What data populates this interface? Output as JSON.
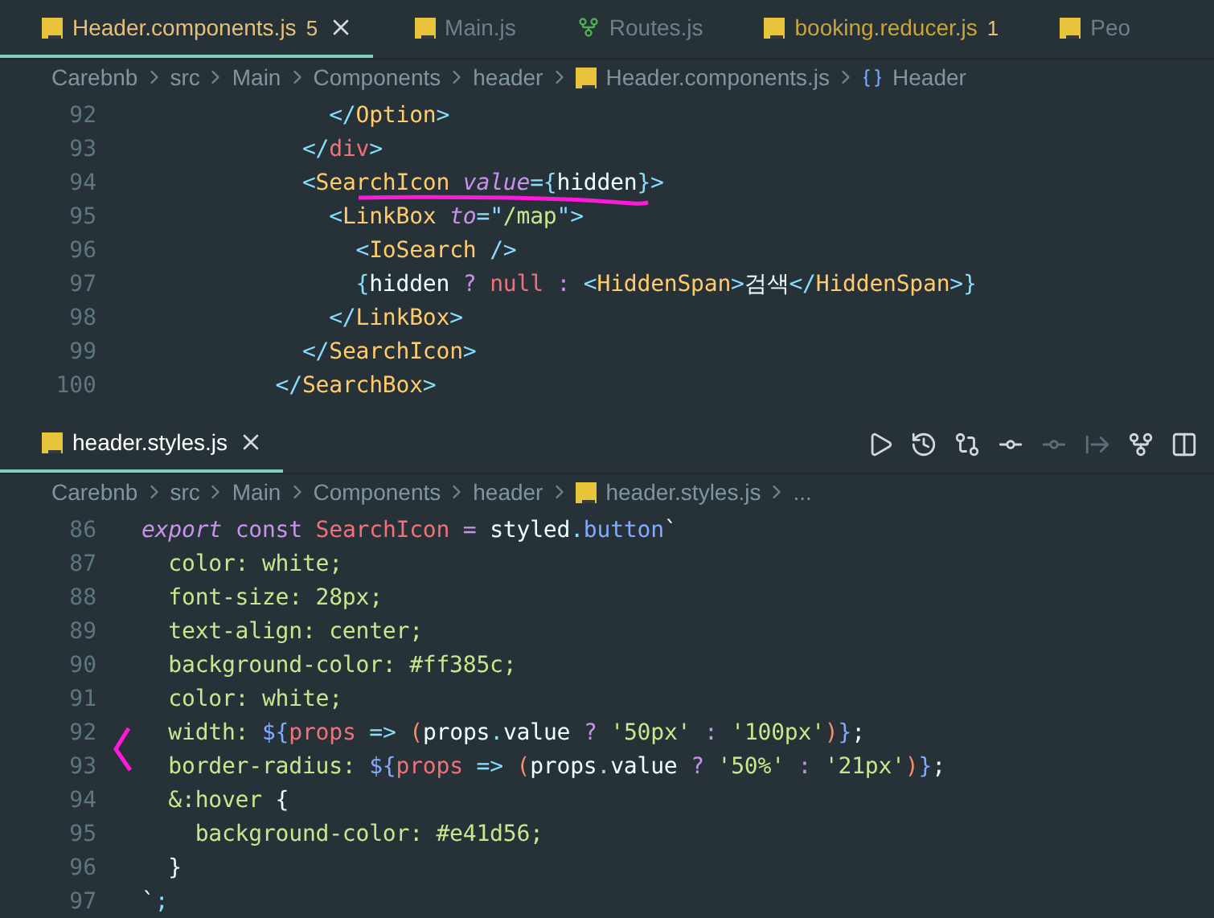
{
  "top_editor": {
    "tabs": [
      {
        "label": "Header.components.js",
        "badge": "5",
        "selected": true,
        "kind": "js",
        "warning": true
      },
      {
        "label": "Main.js",
        "selected": false,
        "kind": "js",
        "warning": false
      },
      {
        "label": "Routes.js",
        "selected": false,
        "kind": "routes",
        "warning": false
      },
      {
        "label": "booking.reducer.js",
        "badge": "1",
        "selected": false,
        "kind": "js",
        "warning": true
      },
      {
        "label": "Peo",
        "selected": false,
        "kind": "js",
        "warning": false
      }
    ],
    "breadcrumbs": [
      {
        "kind": "folder",
        "label": "Carebnb"
      },
      {
        "kind": "folder",
        "label": "src"
      },
      {
        "kind": "folder",
        "label": "Main"
      },
      {
        "kind": "folder",
        "label": "Components"
      },
      {
        "kind": "folder",
        "label": "header"
      },
      {
        "kind": "js",
        "label": "Header.components.js"
      },
      {
        "kind": "symbol",
        "label": "Header"
      }
    ],
    "lines": [
      {
        "number": "92",
        "tokens": [
          {
            "kind": "p",
            "text": "              </"
          },
          {
            "kind": "tag",
            "text": "Option"
          },
          {
            "kind": "p",
            "text": ">"
          }
        ]
      },
      {
        "number": "93",
        "tokens": [
          {
            "kind": "p",
            "text": "            </"
          },
          {
            "kind": "kw",
            "text": "div"
          },
          {
            "kind": "p",
            "text": ">"
          }
        ]
      },
      {
        "number": "94",
        "underlined": true,
        "tokens": [
          {
            "kind": "p",
            "text": "            <"
          },
          {
            "kind": "tag",
            "text": "SearchIcon "
          },
          {
            "kind": "attr",
            "text": "value"
          },
          {
            "kind": "p",
            "text": "={"
          },
          {
            "kind": "id",
            "text": "hidden"
          },
          {
            "kind": "p",
            "text": "}>"
          }
        ]
      },
      {
        "number": "95",
        "tokens": [
          {
            "kind": "p",
            "text": "              <"
          },
          {
            "kind": "tag",
            "text": "LinkBox "
          },
          {
            "kind": "attr",
            "text": "to"
          },
          {
            "kind": "p",
            "text": "=\""
          },
          {
            "kind": "str",
            "text": "/map"
          },
          {
            "kind": "p",
            "text": "\">"
          }
        ]
      },
      {
        "number": "96",
        "tokens": [
          {
            "kind": "p",
            "text": "                <"
          },
          {
            "kind": "tag",
            "text": "IoSearch "
          },
          {
            "kind": "p",
            "text": "/>"
          }
        ]
      },
      {
        "number": "97",
        "tokens": [
          {
            "kind": "p",
            "text": "                {"
          },
          {
            "kind": "id",
            "text": "hidden "
          },
          {
            "kind": "op",
            "text": "? "
          },
          {
            "kind": "kw",
            "text": "null "
          },
          {
            "kind": "op",
            "text": ": "
          },
          {
            "kind": "p",
            "text": "<"
          },
          {
            "kind": "tag",
            "text": "HiddenSpan"
          },
          {
            "kind": "p",
            "text": ">"
          },
          {
            "kind": "id",
            "text": "검색"
          },
          {
            "kind": "p",
            "text": "</"
          },
          {
            "kind": "tag",
            "text": "HiddenSpan"
          },
          {
            "kind": "p",
            "text": ">}"
          }
        ]
      },
      {
        "number": "98",
        "tokens": [
          {
            "kind": "p",
            "text": "              </"
          },
          {
            "kind": "tag",
            "text": "LinkBox"
          },
          {
            "kind": "p",
            "text": ">"
          }
        ]
      },
      {
        "number": "99",
        "tokens": [
          {
            "kind": "p",
            "text": "            </"
          },
          {
            "kind": "tag",
            "text": "SearchIcon"
          },
          {
            "kind": "p",
            "text": ">"
          }
        ]
      },
      {
        "number": "100",
        "tokens": [
          {
            "kind": "p",
            "text": "          </"
          },
          {
            "kind": "tag",
            "text": "SearchBox"
          },
          {
            "kind": "p",
            "text": ">"
          }
        ]
      }
    ]
  },
  "bottom_editor": {
    "tabs": [
      {
        "label": "header.styles.js",
        "selected": true,
        "kind": "js",
        "warning": false
      }
    ],
    "toolbar": [
      {
        "kind": "run",
        "disabled": false
      },
      {
        "kind": "history",
        "disabled": false
      },
      {
        "kind": "compare",
        "disabled": false
      },
      {
        "kind": "commit",
        "disabled": false
      },
      {
        "kind": "commit",
        "disabled": true
      },
      {
        "kind": "next",
        "disabled": true
      },
      {
        "kind": "graph",
        "disabled": false
      },
      {
        "kind": "split",
        "disabled": false
      }
    ],
    "breadcrumbs": [
      {
        "kind": "folder",
        "label": "Carebnb"
      },
      {
        "kind": "folder",
        "label": "src"
      },
      {
        "kind": "folder",
        "label": "Main"
      },
      {
        "kind": "folder",
        "label": "Components"
      },
      {
        "kind": "folder",
        "label": "header"
      },
      {
        "kind": "js",
        "label": "header.styles.js"
      },
      {
        "kind": "more",
        "label": "..."
      }
    ],
    "lines": [
      {
        "number": "86",
        "tokens": [
          {
            "kind": "attr",
            "text": "export "
          },
          {
            "kind": "kw2",
            "text": "const "
          },
          {
            "kind": "kw",
            "text": "SearchIcon "
          },
          {
            "kind": "op",
            "text": "= "
          },
          {
            "kind": "id",
            "text": "styled"
          },
          {
            "kind": "p",
            "text": "."
          },
          {
            "kind": "fn",
            "text": "button"
          },
          {
            "kind": "id",
            "text": "`"
          }
        ]
      },
      {
        "number": "87",
        "tokens": [
          {
            "kind": "str",
            "text": "  color: white;"
          }
        ]
      },
      {
        "number": "88",
        "tokens": [
          {
            "kind": "str",
            "text": "  font-size: 28px;"
          }
        ]
      },
      {
        "number": "89",
        "tokens": [
          {
            "kind": "str",
            "text": "  text-align: center;"
          }
        ]
      },
      {
        "number": "90",
        "tokens": [
          {
            "kind": "str",
            "text": "  background-color: #ff385c;"
          }
        ]
      },
      {
        "number": "91",
        "tokens": [
          {
            "kind": "str",
            "text": "  color: white;"
          }
        ]
      },
      {
        "number": "92",
        "tokens": [
          {
            "kind": "str",
            "text": "  width: "
          },
          {
            "kind": "fn",
            "text": "${"
          },
          {
            "kind": "kw",
            "text": "props "
          },
          {
            "kind": "p",
            "text": "=> "
          },
          {
            "kind": "paren",
            "text": "("
          },
          {
            "kind": "id",
            "text": "props"
          },
          {
            "kind": "p",
            "text": "."
          },
          {
            "kind": "id",
            "text": "value "
          },
          {
            "kind": "op",
            "text": "? "
          },
          {
            "kind": "str",
            "text": "'50px' "
          },
          {
            "kind": "op",
            "text": ": "
          },
          {
            "kind": "str",
            "text": "'100px'"
          },
          {
            "kind": "paren",
            "text": ")"
          },
          {
            "kind": "fn",
            "text": "}"
          },
          {
            "kind": "id",
            "text": ";"
          }
        ]
      },
      {
        "number": "93",
        "bracketed": true,
        "tokens": [
          {
            "kind": "str",
            "text": "  border-radius: "
          },
          {
            "kind": "fn",
            "text": "${"
          },
          {
            "kind": "kw",
            "text": "props "
          },
          {
            "kind": "p",
            "text": "=> "
          },
          {
            "kind": "paren",
            "text": "("
          },
          {
            "kind": "id",
            "text": "props"
          },
          {
            "kind": "p",
            "text": "."
          },
          {
            "kind": "id",
            "text": "value "
          },
          {
            "kind": "op",
            "text": "? "
          },
          {
            "kind": "str",
            "text": "'50%' "
          },
          {
            "kind": "op",
            "text": ": "
          },
          {
            "kind": "str",
            "text": "'21px'"
          },
          {
            "kind": "paren",
            "text": ")"
          },
          {
            "kind": "fn",
            "text": "}"
          },
          {
            "kind": "id",
            "text": ";"
          }
        ]
      },
      {
        "number": "94",
        "tokens": [
          {
            "kind": "str",
            "text": "  &:hover "
          },
          {
            "kind": "id",
            "text": "{"
          }
        ]
      },
      {
        "number": "95",
        "tokens": [
          {
            "kind": "str",
            "text": "    background-color: #e41d56;"
          }
        ]
      },
      {
        "number": "96",
        "tokens": [
          {
            "kind": "id",
            "text": "  }"
          }
        ]
      },
      {
        "number": "97",
        "tokens": [
          {
            "kind": "id",
            "text": "`"
          },
          {
            "kind": "p",
            "text": ";"
          }
        ]
      }
    ]
  }
}
